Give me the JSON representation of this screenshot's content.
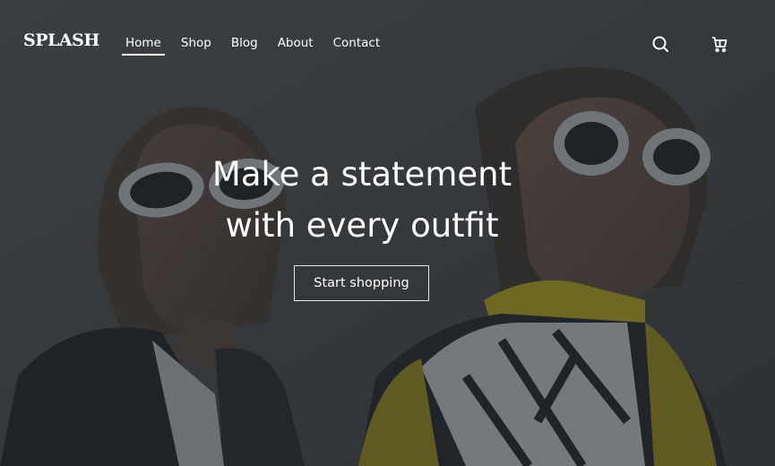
{
  "header": {
    "logo": "SPLASH",
    "nav": [
      {
        "label": "Home",
        "active": true
      },
      {
        "label": "Shop",
        "active": false
      },
      {
        "label": "Blog",
        "active": false
      },
      {
        "label": "About",
        "active": false
      },
      {
        "label": "Contact",
        "active": false
      }
    ],
    "icons": [
      "search-icon",
      "cart-icon"
    ]
  },
  "hero": {
    "headline_line1": "Make a statement",
    "headline_line2": "with every outfit",
    "cta_label": "Start shopping",
    "image_description": ""
  },
  "colors": {
    "overlay": "#2c3034",
    "text": "#ffffff",
    "accent_yellow": "#c8b81e"
  }
}
